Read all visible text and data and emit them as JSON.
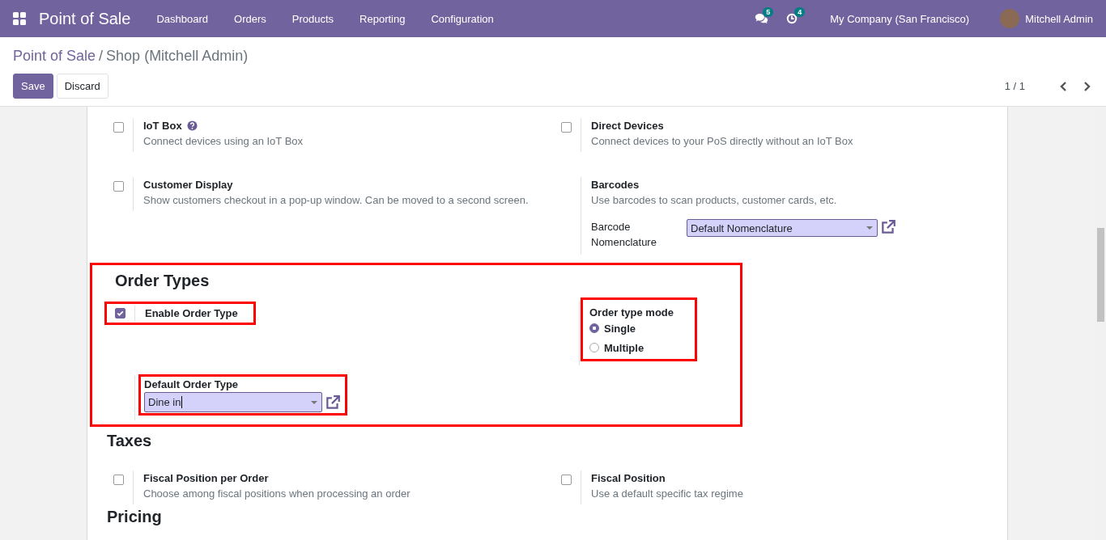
{
  "navbar": {
    "app_title": "Point of Sale",
    "menu": [
      "Dashboard",
      "Orders",
      "Products",
      "Reporting",
      "Configuration"
    ],
    "messages_badge": "5",
    "activities_badge": "4",
    "company": "My Company (San Francisco)",
    "user": "Mitchell Admin"
  },
  "breadcrumb": {
    "parent": "Point of Sale",
    "separator": "/",
    "current": "Shop (Mitchell Admin)"
  },
  "buttons": [
    {
      "label": "Save",
      "kind": "primary"
    },
    {
      "label": "Discard",
      "kind": "secondary"
    }
  ],
  "pager": "1 / 1",
  "devices": [
    {
      "kind": "checkbox",
      "title": "IoT Box",
      "help": true,
      "checked": false,
      "description": "Connect devices using an IoT Box"
    },
    {
      "kind": "checkbox",
      "title": "Direct Devices",
      "checked": false,
      "description": "Connect devices to your PoS directly without an IoT Box"
    },
    {
      "kind": "checkbox",
      "title": "Customer Display",
      "checked": false,
      "description": "Show customers checkout in a pop-up window. Can be moved to a second screen."
    },
    {
      "kind": "field",
      "title": "Barcodes",
      "description": "Use barcodes to scan products, customer cards, etc.",
      "field_label": "Barcode Nomenclature",
      "value": "Default Nomenclature"
    }
  ],
  "order_types": {
    "heading": "Order Types",
    "highlighted": true,
    "enable": {
      "label": "Enable Order Type",
      "checked": true,
      "highlighted": true
    },
    "mode": {
      "label": "Order type mode",
      "highlighted": true,
      "options": [
        {
          "label": "Single",
          "selected": true
        },
        {
          "label": "Multiple",
          "selected": false
        }
      ]
    },
    "default": {
      "label": "Default Order Type",
      "value": "Dine in",
      "highlighted": true
    }
  },
  "taxes": {
    "heading": "Taxes",
    "items": [
      {
        "title": "Fiscal Position per Order",
        "checked": false,
        "description": "Choose among fiscal positions when processing an order"
      },
      {
        "title": "Fiscal Position",
        "checked": false,
        "description": "Use a default specific tax regime"
      }
    ]
  },
  "pricing": {
    "heading": "Pricing"
  }
}
